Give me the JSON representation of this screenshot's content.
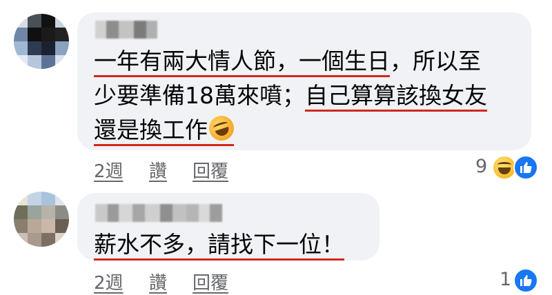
{
  "comments": [
    {
      "text_lines": [
        {
          "parts": [
            {
              "text": "一年有兩大情人節，一個生日",
              "underline": true
            },
            {
              "text": "，所以至",
              "underline": false
            }
          ]
        },
        {
          "parts": [
            {
              "text": "少要準備18萬來噴；",
              "underline": false
            },
            {
              "text": "自己算算該換女友",
              "underline": true
            }
          ]
        },
        {
          "parts": [
            {
              "text": "還是換工作",
              "underline": true
            }
          ]
        }
      ],
      "emoji_icon": "rolling-on-floor-laughing-emoji",
      "actions": {
        "time": "2週",
        "like": "讚",
        "reply": "回覆"
      },
      "reaction_count": "9",
      "reactions": [
        "haha-icon",
        "like-icon"
      ]
    },
    {
      "text_lines": [
        {
          "parts": [
            {
              "text": "薪水不多，請找下一位！",
              "underline": true
            }
          ]
        }
      ],
      "actions": {
        "time": "2週",
        "like": "讚",
        "reply": "回覆"
      },
      "reaction_count": "1",
      "reactions": [
        "like-icon"
      ]
    }
  ],
  "colors": {
    "bubble": "#f0f2f5",
    "underline": "#d3271e",
    "meta_text": "#65676b",
    "like_blue": "#1877f2"
  }
}
